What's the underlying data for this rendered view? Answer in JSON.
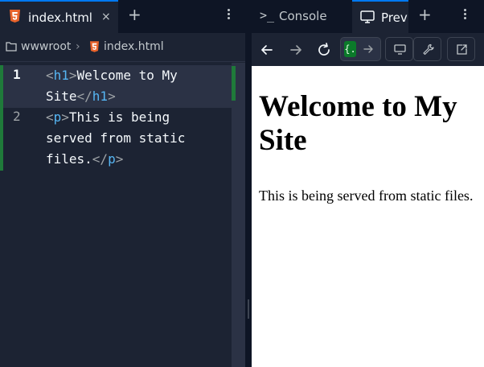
{
  "editor": {
    "tab": {
      "label": "index.html",
      "close": "×",
      "add": "+"
    },
    "breadcrumb": {
      "root": "wwwroot",
      "separator": "›",
      "file": "index.html"
    },
    "lines": [
      {
        "number": "1",
        "open_bracket": "<",
        "open_tag": "h1",
        "open_close": ">",
        "text_a": "Welcome to My",
        "text_b": "Site",
        "close_bracket": "</",
        "close_tag": "h1",
        "close_end": ">"
      },
      {
        "number": "2",
        "open_bracket": "<",
        "open_tag": "p",
        "open_close": ">",
        "text_a": "This is being",
        "text_b": "served from static",
        "text_c": "files.",
        "close_bracket": "</",
        "close_tag": "p",
        "close_end": ">"
      }
    ]
  },
  "preview": {
    "tabs": {
      "console": "Console",
      "console_icon": ">_",
      "webview": "Preview",
      "add": "+"
    },
    "url_badge": "{.",
    "page": {
      "heading": "Welcome to My Site",
      "paragraph": "This is being served from static files."
    }
  },
  "colors": {
    "accent": "#0079f2",
    "git_added": "#1f7a3a",
    "tag": "#56b6f4",
    "html5": "#e8632b"
  },
  "icons": [
    "html5-file-icon",
    "folder-icon",
    "close-icon",
    "plus-icon",
    "more-vertical-icon",
    "terminal-icon",
    "monitor-icon",
    "arrow-left-icon",
    "arrow-right-icon",
    "refresh-icon",
    "devices-icon",
    "wrench-icon",
    "external-link-icon"
  ]
}
